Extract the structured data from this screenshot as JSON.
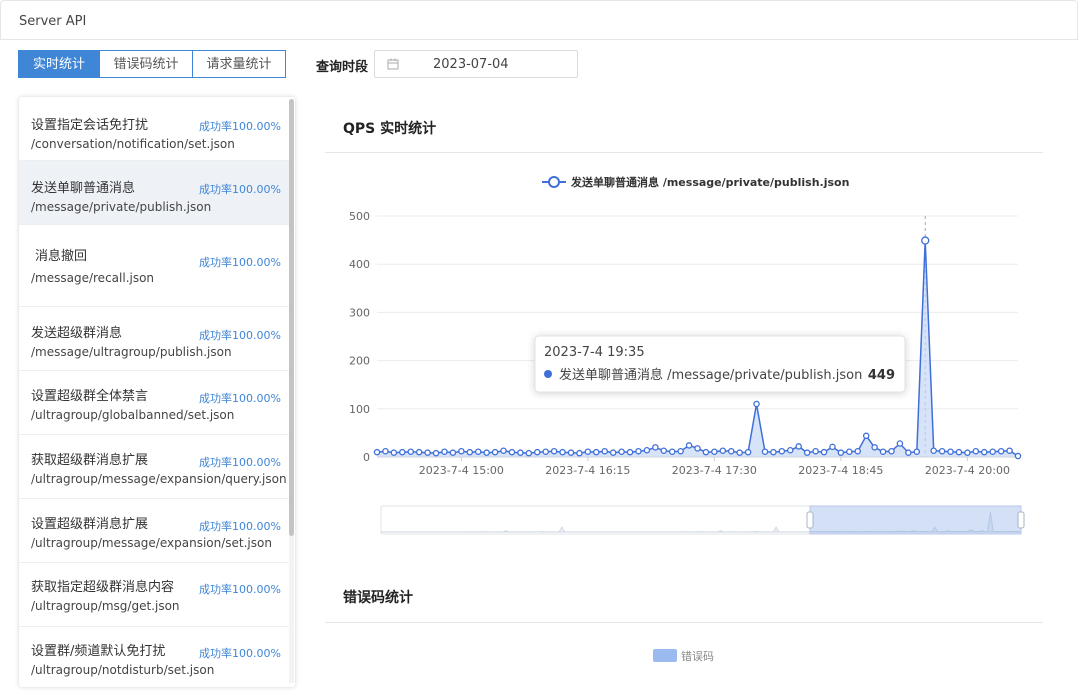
{
  "header": {
    "title": "Server API"
  },
  "tabs": [
    {
      "label": "实时统计",
      "active": true
    },
    {
      "label": "错误码统计",
      "active": false
    },
    {
      "label": "请求量统计",
      "active": false
    }
  ],
  "query": {
    "label": "查询时段",
    "date": "2023-07-04",
    "icon": "calendar-icon"
  },
  "api_list": [
    {
      "name": "设置指定会话免打扰",
      "path": "/conversation/notification/set.json",
      "rate": "成功率100.00%",
      "selected": false
    },
    {
      "name": "发送单聊普通消息",
      "path": "/message/private/publish.json",
      "rate": "成功率100.00%",
      "selected": true
    },
    {
      "name": "消息撤回",
      "path": "/message/recall.json",
      "rate": "成功率100.00%",
      "selected": false
    },
    {
      "name": "发送超级群消息",
      "path": "/message/ultragroup/publish.json",
      "rate": "成功率100.00%",
      "selected": false
    },
    {
      "name": "设置超级群全体禁言",
      "path": "/ultragroup/globalbanned/set.json",
      "rate": "成功率100.00%",
      "selected": false
    },
    {
      "name": "获取超级群消息扩展",
      "path": "/ultragroup/message/expansion/query.json",
      "rate": "成功率100.00%",
      "selected": false
    },
    {
      "name": "设置超级群消息扩展",
      "path": "/ultragroup/message/expansion/set.json",
      "rate": "成功率100.00%",
      "selected": false
    },
    {
      "name": "获取指定超级群消息内容",
      "path": "/ultragroup/msg/get.json",
      "rate": "成功率100.00%",
      "selected": false
    },
    {
      "name": "设置群/频道默认免打扰",
      "path": "/ultragroup/notdisturb/set.json",
      "rate": "成功率100.00%",
      "selected": false
    }
  ],
  "qps": {
    "title": "QPS 实时统计"
  },
  "errors": {
    "title": "错误码统计",
    "legend": "错误码",
    "legend_color": "#9bbaf0"
  },
  "tooltip": {
    "time": "2023-7-4 19:35",
    "series": "发送单聊普通消息 /message/private/publish.json",
    "value": "449"
  },
  "chart_data": {
    "type": "line",
    "title": "",
    "xlabel": "",
    "ylabel": "",
    "ylim": [
      0,
      500
    ],
    "yticks": [
      "0",
      "100",
      "200",
      "300",
      "400",
      "500"
    ],
    "xticks": [
      {
        "label": "2023-7-4 15:00",
        "index": 10
      },
      {
        "label": "2023-7-4 16:15",
        "index": 25
      },
      {
        "label": "2023-7-4 17:30",
        "index": 40
      },
      {
        "label": "2023-7-4 18:45",
        "index": 55
      },
      {
        "label": "2023-7-4 20:00",
        "index": 70
      }
    ],
    "grid": true,
    "legend": "top-center",
    "accent_color": "#3f6fd8",
    "fill_color": "#c5d7f5",
    "series": [
      {
        "name": "发送单聊普通消息 /message/private/publish.json",
        "values": [
          10,
          12,
          9,
          10,
          11,
          10,
          9,
          8,
          11,
          9,
          12,
          10,
          11,
          9,
          10,
          13,
          10,
          9,
          8,
          10,
          11,
          12,
          10,
          9,
          8,
          11,
          10,
          12,
          9,
          11,
          10,
          12,
          14,
          20,
          13,
          11,
          12,
          24,
          18,
          10,
          11,
          13,
          12,
          9,
          10,
          110,
          11,
          10,
          12,
          14,
          22,
          9,
          12,
          10,
          21,
          9,
          11,
          12,
          44,
          20,
          11,
          12,
          28,
          9,
          11,
          449,
          13,
          12,
          11,
          10,
          9,
          12,
          10,
          11,
          12,
          13,
          2
        ]
      }
    ],
    "highlight_index": 65
  }
}
